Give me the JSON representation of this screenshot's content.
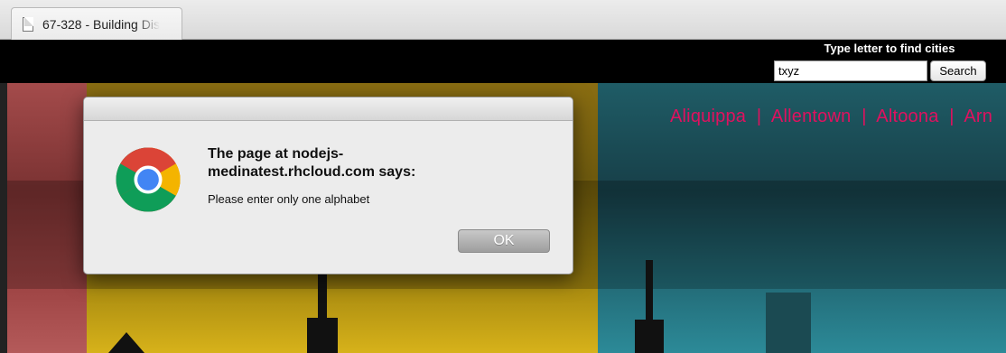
{
  "tab": {
    "title": "67-328 - Building Dis",
    "icon": "document-icon"
  },
  "header": {
    "hint": "Type letter to find cities",
    "search_value": "txyz",
    "search_button": "Search"
  },
  "cities": [
    "Aliquippa",
    "|",
    "Allentown",
    "|",
    "Altoona",
    "|",
    "Arn"
  ],
  "dialog": {
    "title": "The page at nodejs-medinatest.rhcloud.com says:",
    "message": "Please enter only one alphabet",
    "ok": "OK",
    "icon": "chrome-icon"
  },
  "colors": {
    "city_link": "#e0115f"
  }
}
